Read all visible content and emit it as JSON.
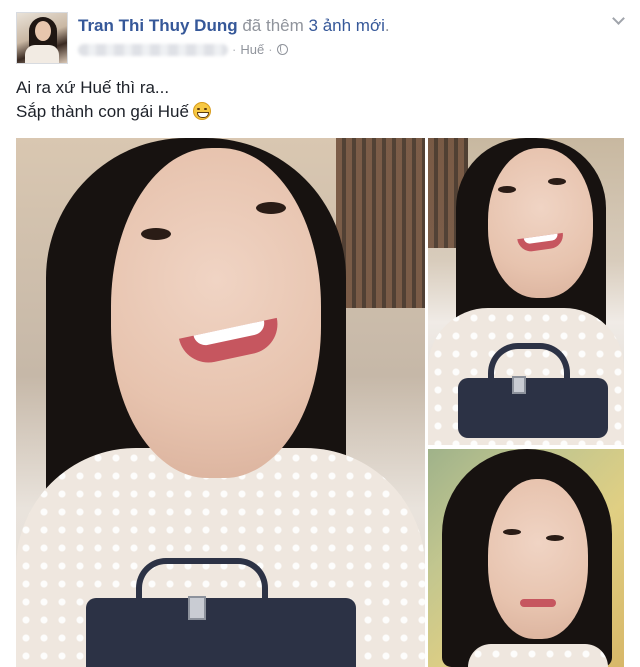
{
  "post": {
    "author": "Tran Thi Thuy Dung",
    "action_text": "đã thêm",
    "action_count": "3 ảnh mới",
    "action_tail": ".",
    "location": "Huế",
    "separator": "·",
    "caption_lines": [
      "Ai ra xứ Huế thì ra...",
      "Sắp thành con gái Huế"
    ]
  },
  "icons": {
    "privacy": "globe-icon",
    "options": "chevron-down-icon",
    "emoji": "grin-emoji-icon"
  },
  "photos": [
    {
      "id": "main",
      "description": "selfie"
    },
    {
      "id": "right-top",
      "description": "selfie"
    },
    {
      "id": "right-bottom",
      "description": "selfie"
    }
  ],
  "colors": {
    "link": "#365899",
    "meta": "#90949c",
    "text": "#1d2129"
  }
}
